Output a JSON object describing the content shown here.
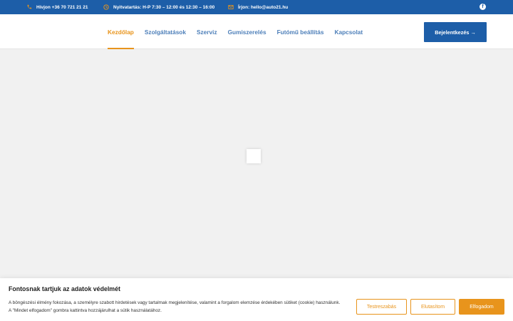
{
  "topbar": {
    "phone": "Hívjon +36 70 721 21 21",
    "phone_icon": "phone-icon",
    "hours": "Nyitvatartás: H-P 7:30 – 12:00 és 12:30 – 16:00",
    "hours_icon": "clock-icon",
    "email": "Írjon: hello@auto21.hu",
    "email_icon": "envelope-icon",
    "social_icon": "facebook-icon",
    "facebook_glyph": "f",
    "icon_color": "#e8941c",
    "background": "#1d5ea8"
  },
  "nav": {
    "items": [
      {
        "label": "Kezdőlap",
        "active": true
      },
      {
        "label": "Szolgáltatások"
      },
      {
        "label": "Szerviz"
      },
      {
        "label": "Gumiszerelés"
      },
      {
        "label": "Futómű beállítás"
      },
      {
        "label": "Kapcsolat"
      }
    ],
    "active_color": "#e8941c",
    "link_color": "#4d7fb9"
  },
  "login_button": {
    "label": "Bejelentkezés →"
  },
  "cookie": {
    "title": "Fontosnak tartjuk az adatok védelmét",
    "text": "A böngészési élmény fokozása, a személyre szabott hirdetések vagy tartalmak megjelenítése, valamint a forgalom elemzése érdekében sütiket (cookie) használunk. A \"Mindet elfogadom\" gombra kattintva hozzájárulhat a sütik használatához.",
    "customize_label": "Testreszabás",
    "reject_label": "Elutasítom",
    "accept_label": "Elfogadom",
    "accent": "#e8941c"
  }
}
